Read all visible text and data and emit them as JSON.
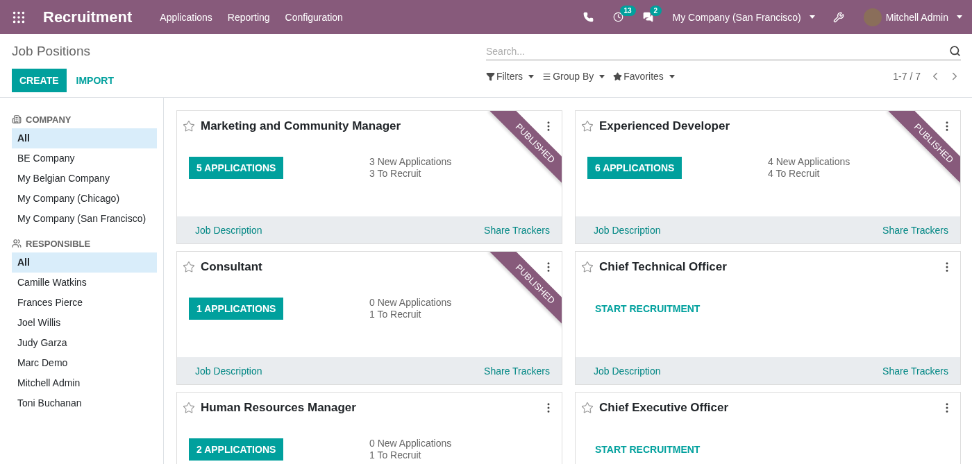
{
  "navbar": {
    "app_title": "Recruitment",
    "menu": [
      "Applications",
      "Reporting",
      "Configuration"
    ],
    "activity_badge": "13",
    "messages_badge": "2",
    "company": "My Company (San Francisco)",
    "user": "Mitchell Admin"
  },
  "control_panel": {
    "breadcrumb": "Job Positions",
    "buttons": [
      "CREATE",
      "IMPORT"
    ],
    "search": {
      "placeholder": "Search..."
    },
    "filters": [
      "Filters",
      "Group By",
      "Favorites"
    ],
    "pager": "1-7 / 7"
  },
  "sidebar": {
    "sections": [
      {
        "kind": "company",
        "title": "COMPANY",
        "items": [
          {
            "label": "All",
            "selected": true
          },
          {
            "label": "BE Company",
            "selected": false
          },
          {
            "label": "My Belgian Company",
            "selected": false
          },
          {
            "label": "My Company (Chicago)",
            "selected": false
          },
          {
            "label": "My Company (San Francisco)",
            "selected": false
          }
        ]
      },
      {
        "kind": "responsible",
        "title": "RESPONSIBLE",
        "items": [
          {
            "label": "All",
            "selected": true
          },
          {
            "label": "Camille Watkins",
            "selected": false
          },
          {
            "label": "Frances Pierce",
            "selected": false
          },
          {
            "label": "Joel Willis",
            "selected": false
          },
          {
            "label": "Judy Garza",
            "selected": false
          },
          {
            "label": "Marc Demo",
            "selected": false
          },
          {
            "label": "Mitchell Admin",
            "selected": false
          },
          {
            "label": "Toni Buchanan",
            "selected": false
          }
        ]
      }
    ]
  },
  "cards": [
    {
      "title": "Marketing and Community Manager",
      "kind": "applications",
      "action": "5 APPLICATIONS",
      "new_applications": "3 New Applications",
      "to_recruit": "3 To Recruit",
      "published": true,
      "ribbon": "PUBLISHED",
      "footer_left": "Job Description",
      "footer_right": "Share Trackers"
    },
    {
      "title": "Experienced Developer",
      "kind": "applications",
      "action": "6 APPLICATIONS",
      "new_applications": "4 New Applications",
      "to_recruit": "4 To Recruit",
      "published": true,
      "ribbon": "PUBLISHED",
      "footer_left": "Job Description",
      "footer_right": "Share Trackers"
    },
    {
      "title": "Consultant",
      "kind": "applications",
      "action": "1 APPLICATIONS",
      "new_applications": "0 New Applications",
      "to_recruit": "1 To Recruit",
      "published": true,
      "ribbon": "PUBLISHED",
      "footer_left": "Job Description",
      "footer_right": "Share Trackers"
    },
    {
      "title": "Chief Technical Officer",
      "kind": "start",
      "action": "START RECRUITMENT",
      "published": false,
      "footer_left": "Job Description",
      "footer_right": "Share Trackers"
    },
    {
      "title": "Human Resources Manager",
      "kind": "applications",
      "action": "2 APPLICATIONS",
      "new_applications": "0 New Applications",
      "to_recruit": "1 To Recruit",
      "published": false
    },
    {
      "title": "Chief Executive Officer",
      "kind": "start",
      "action": "START RECRUITMENT",
      "published": false
    }
  ]
}
